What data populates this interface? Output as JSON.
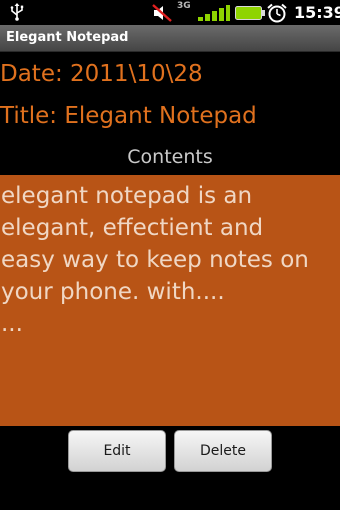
{
  "status_bar": {
    "usb_icon": "usb-icon",
    "mute_icon": "vibrate-muted-icon",
    "network_type": "3G",
    "signal_icon": "signal-bars-icon",
    "battery_icon": "battery-icon",
    "alarm_icon": "alarm-icon",
    "time": "15:39"
  },
  "app": {
    "title": "Elegant Notepad"
  },
  "note": {
    "date_line": "Date: 2011\\10\\28",
    "title_line": "Title: Elegant Notepad",
    "contents_label": "Contents",
    "contents_text": "elegant notepad is an\nelegant, effectient and\neasy way to keep notes on\nyour phone. with....\n..."
  },
  "actions": {
    "edit_label": "Edit",
    "delete_label": "Delete"
  },
  "colors": {
    "accent_orange": "#e0711e",
    "contents_background": "#b85416",
    "contents_text": "#f0d7c4",
    "title_bar": "#5a5a5a"
  }
}
